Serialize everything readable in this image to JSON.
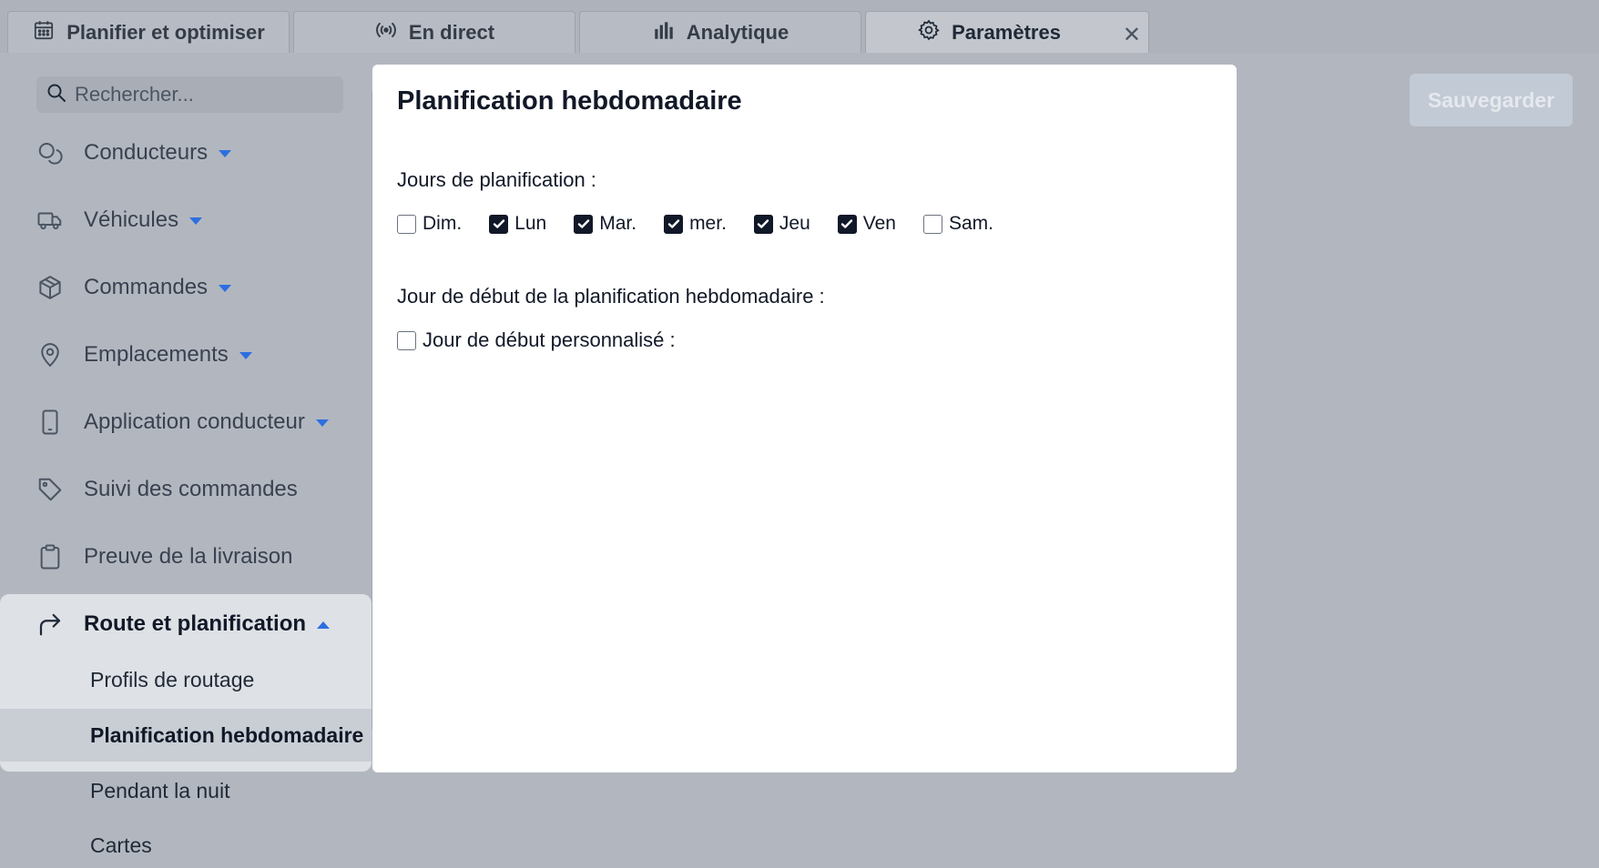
{
  "tabs": [
    {
      "label": "Planifier et optimiser",
      "icon": "calendar-icon"
    },
    {
      "label": "En direct",
      "icon": "broadcast-icon"
    },
    {
      "label": "Analytique",
      "icon": "bar-chart-icon"
    },
    {
      "label": "Paramètres",
      "icon": "gear-icon",
      "active": true,
      "close": "✕"
    }
  ],
  "sidebar": {
    "search_placeholder": "Rechercher...",
    "items": [
      {
        "label": "Conducteurs",
        "icon": "drivers-icon"
      },
      {
        "label": "Véhicules",
        "icon": "truck-icon"
      },
      {
        "label": "Commandes",
        "icon": "package-icon"
      },
      {
        "label": "Emplacements",
        "icon": "map-pin-icon"
      },
      {
        "label": "Application conducteur",
        "icon": "phone-icon"
      },
      {
        "label": "Suivi des commandes",
        "icon": "tag-icon"
      },
      {
        "label": "Preuve de la livraison",
        "icon": "clipboard-icon"
      },
      {
        "label": "Route et planification",
        "icon": "route-arrow-icon"
      }
    ],
    "route_subitems": [
      "Profils de routage",
      "Planification hebdomadaire",
      "Pendant la nuit",
      "Cartes"
    ],
    "active_subitem": "Planification hebdomadaire"
  },
  "main": {
    "title": "Planification hebdomadaire",
    "days_label": "Jours de planification :",
    "days": [
      {
        "label": "Dim.",
        "checked": false
      },
      {
        "label": "Lun",
        "checked": true
      },
      {
        "label": "Mar.",
        "checked": true
      },
      {
        "label": "mer.",
        "checked": true
      },
      {
        "label": "Jeu",
        "checked": true
      },
      {
        "label": "Ven",
        "checked": true
      },
      {
        "label": "Sam.",
        "checked": false
      }
    ],
    "start_day_label": "Jour de début de la planification hebdomadaire :",
    "custom_start_label": "Jour de début personnalisé :",
    "custom_start_checked": false
  },
  "save_label": "Sauvegarder",
  "colors": {
    "accent": "#2e6fe0",
    "checkbox_checked": "#111827"
  }
}
